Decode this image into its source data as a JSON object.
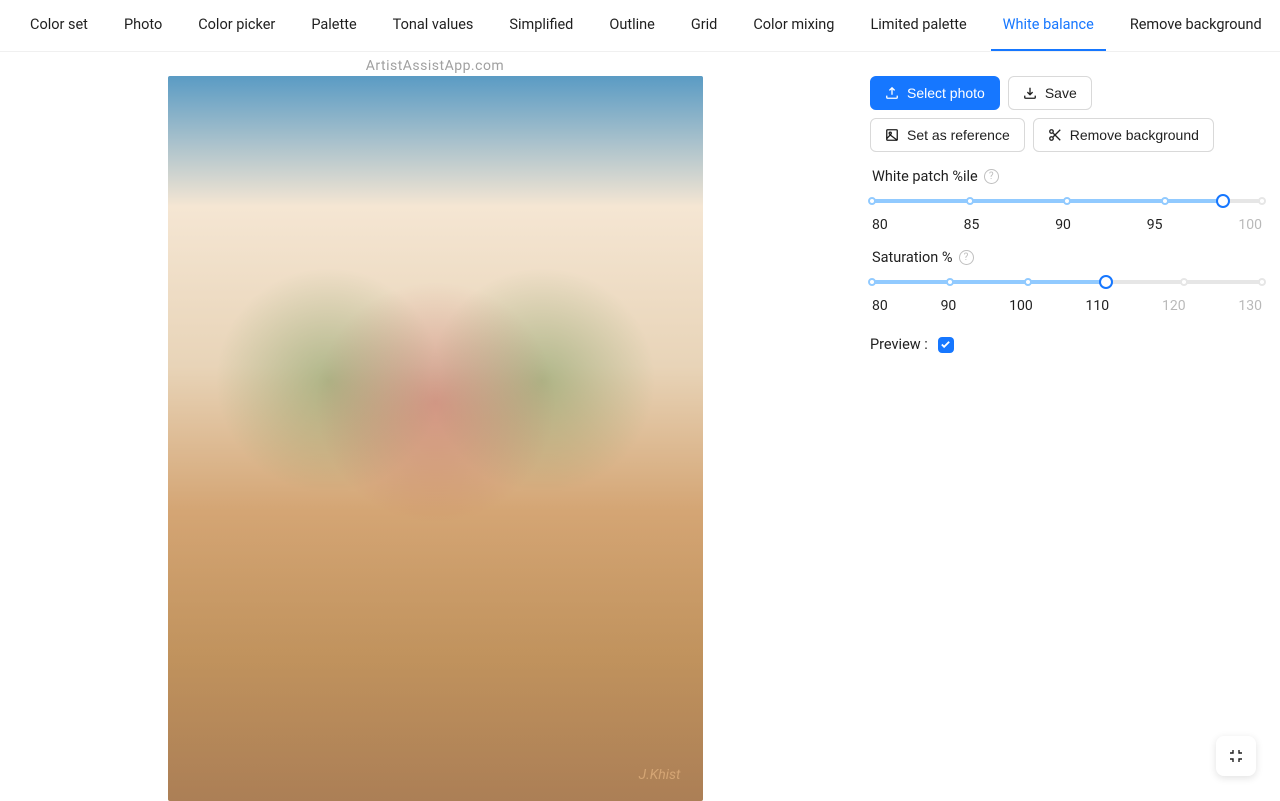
{
  "watermark": "ArtistAssistApp.com",
  "tabs": {
    "items": [
      "Color set",
      "Photo",
      "Color picker",
      "Palette",
      "Tonal values",
      "Simplified",
      "Outline",
      "Grid",
      "Color mixing",
      "Limited palette",
      "White balance",
      "Remove background"
    ],
    "active_index": 10
  },
  "buttons": {
    "select_photo": "Select photo",
    "save": "Save",
    "set_reference": "Set as reference",
    "remove_bg": "Remove background"
  },
  "controls": {
    "white_patch": {
      "label": "White patch %ile",
      "min": 80,
      "max": 100,
      "value": 98,
      "marks": [
        "80",
        "85",
        "90",
        "95",
        "100"
      ]
    },
    "saturation": {
      "label": "Saturation %",
      "min": 80,
      "max": 130,
      "value": 110,
      "marks": [
        "80",
        "90",
        "100",
        "110",
        "120",
        "130"
      ]
    },
    "preview": {
      "label": "Preview :",
      "checked": true
    }
  },
  "image": {
    "signature": "J.Khist"
  },
  "colors": {
    "primary": "#1677ff"
  }
}
